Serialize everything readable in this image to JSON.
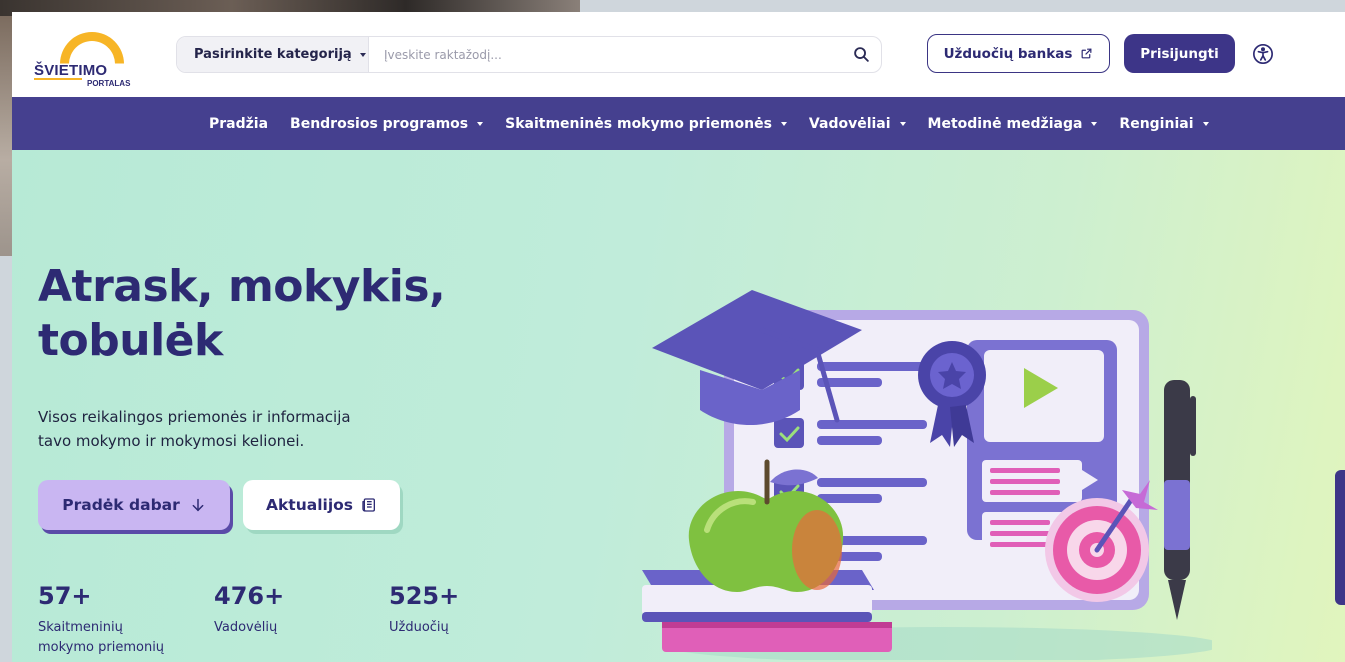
{
  "logo": {
    "word": "ŠVIETIMO",
    "sub": "PORTALAS"
  },
  "search": {
    "category_label": "Pasirinkite kategoriją",
    "placeholder": "Įveskite raktažodį..."
  },
  "header": {
    "bank_label": "Užduočių bankas",
    "login_label": "Prisijungti"
  },
  "nav": {
    "items": [
      {
        "label": "Pradžia",
        "dropdown": false
      },
      {
        "label": "Bendrosios programos",
        "dropdown": true
      },
      {
        "label": "Skaitmeninės mokymo priemonės",
        "dropdown": true
      },
      {
        "label": "Vadovėliai",
        "dropdown": true
      },
      {
        "label": "Metodinė medžiaga",
        "dropdown": true
      },
      {
        "label": "Renginiai",
        "dropdown": true
      }
    ]
  },
  "hero": {
    "title_line1": "Atrask, mokykis,",
    "title_line2": "tobulėk",
    "subtitle_line1": "Visos reikalingos priemonės ir informacija",
    "subtitle_line2": "tavo mokymo ir mokymosi kelionei.",
    "start_label": "Pradėk dabar",
    "news_label": "Aktualijos"
  },
  "stats": [
    {
      "number": "57+",
      "label_line1": "Skaitmeninių",
      "label_line2": "mokymo priemonių"
    },
    {
      "number": "476+",
      "label_line1": "Vadovėlių",
      "label_line2": ""
    },
    {
      "number": "525+",
      "label_line1": "Užduočių",
      "label_line2": ""
    }
  ],
  "colors": {
    "brand": "#2d2a73",
    "nav_bg": "#45408f",
    "accent_yellow": "#f7b526",
    "button_primary": "#3d3588",
    "button_lavender": "#c9b6f2"
  },
  "icons": {
    "search": "search-icon",
    "external": "external-link-icon",
    "accessibility": "accessibility-icon",
    "arrow_down": "arrow-down-icon",
    "news": "newspaper-icon"
  }
}
